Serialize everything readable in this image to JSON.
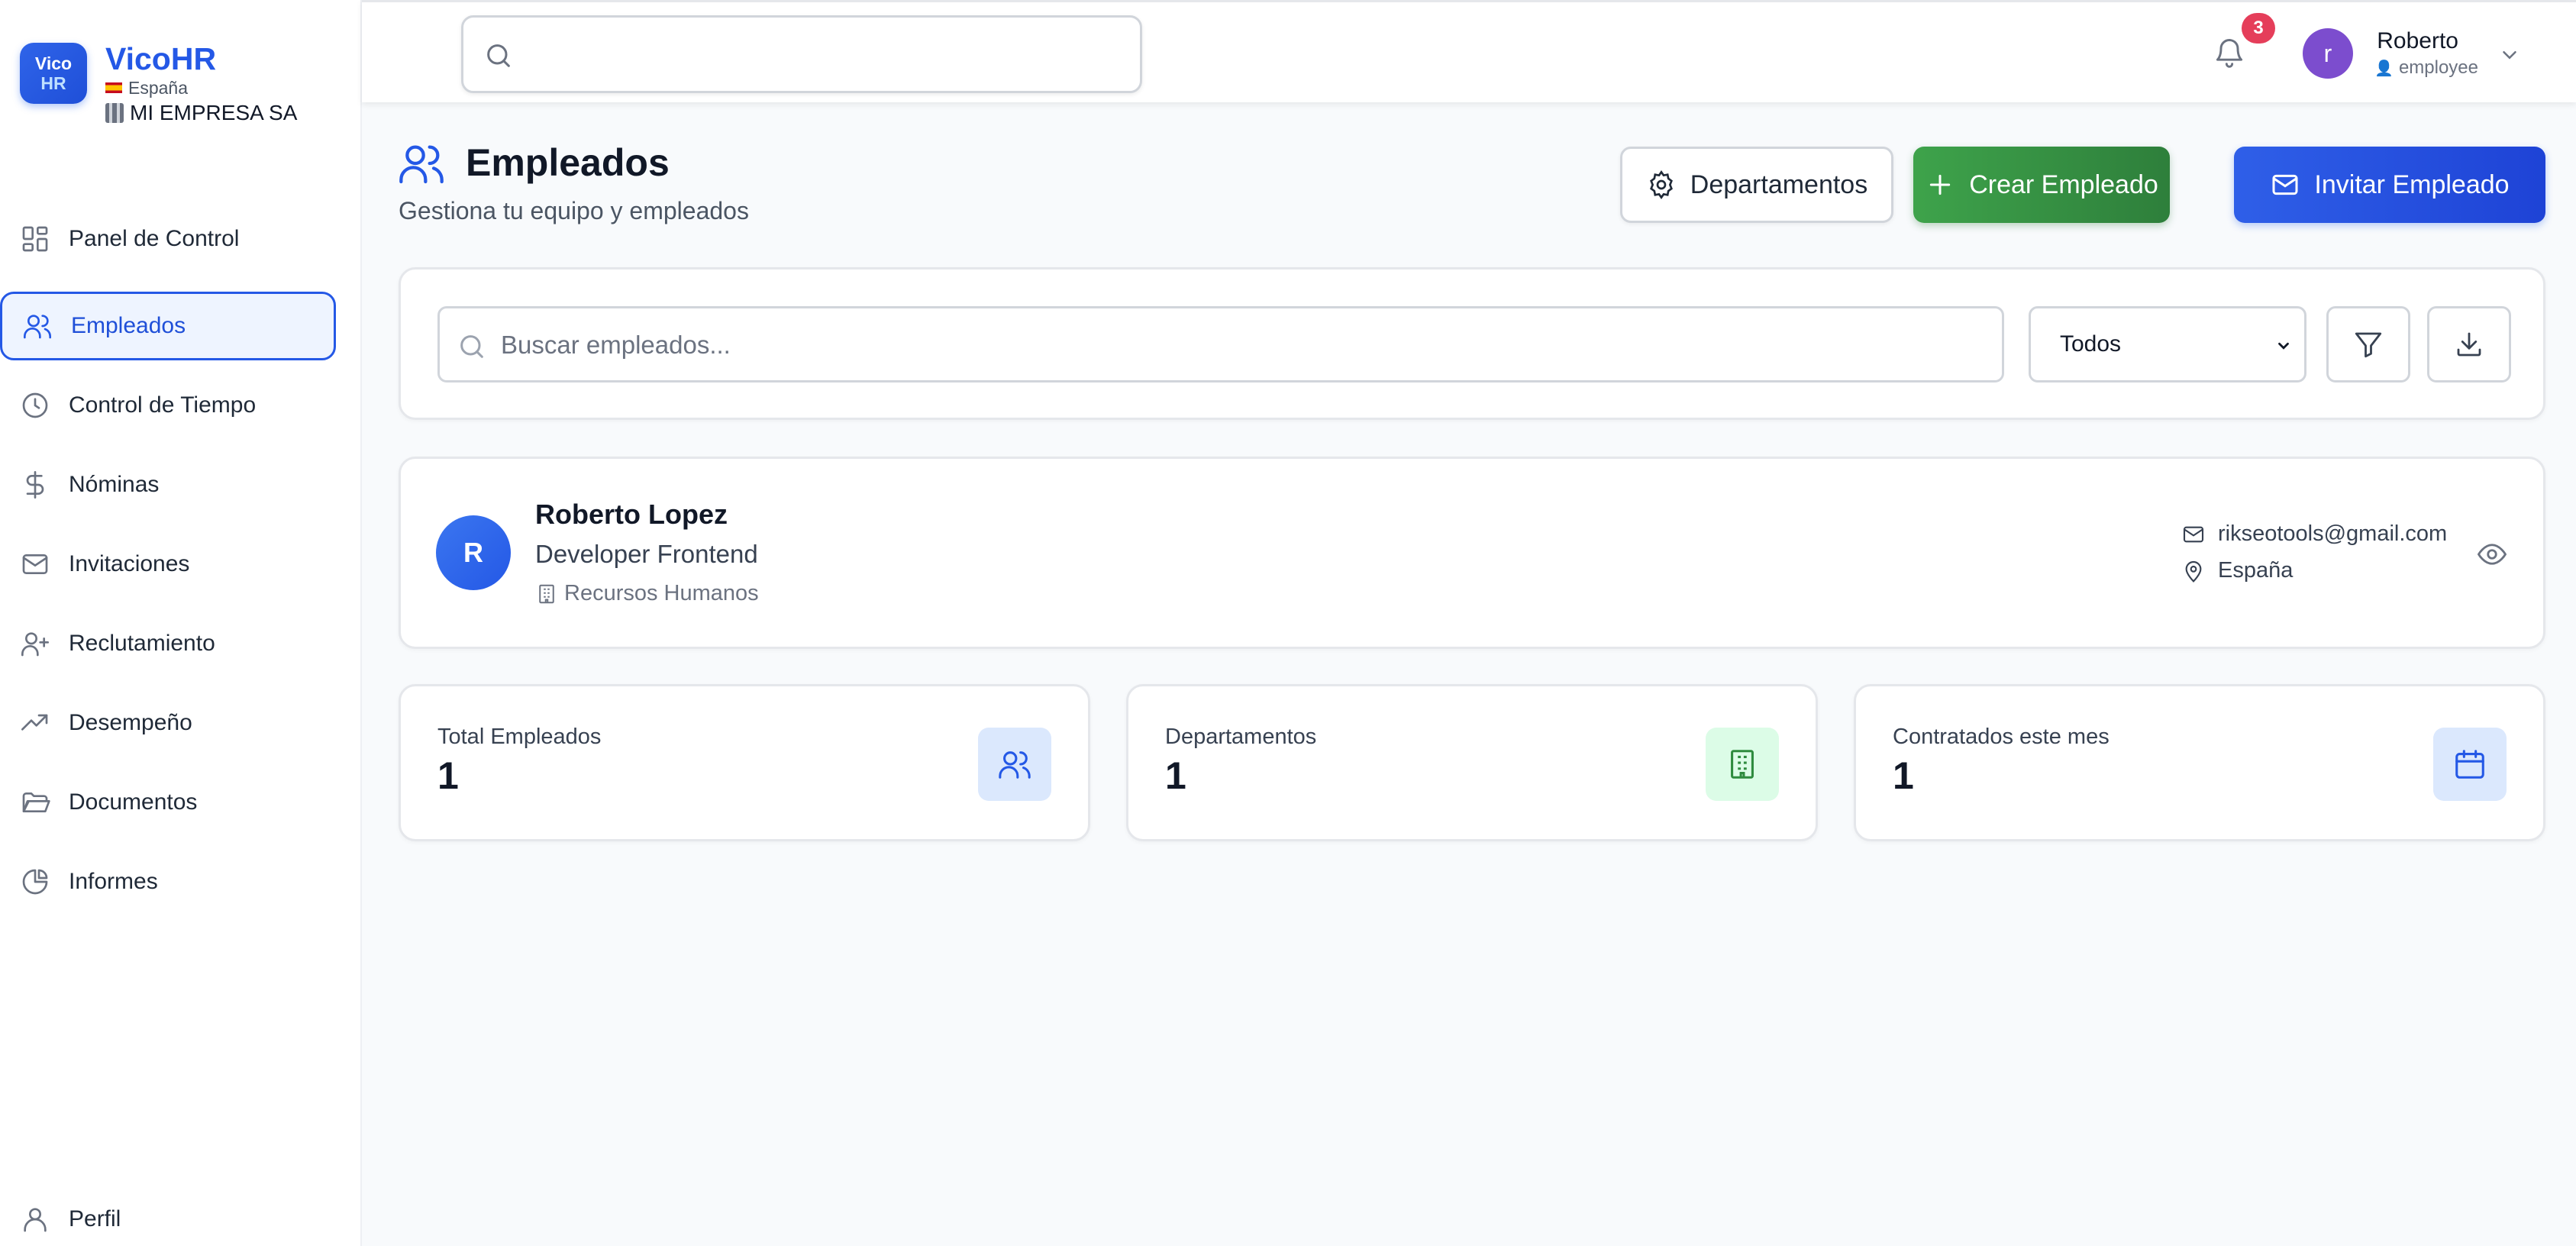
{
  "brand": {
    "logo_line1": "Vico",
    "logo_line2": "HR",
    "name": "VicoHR",
    "country": "España",
    "company": "MI EMPRESA SA"
  },
  "sidebar": {
    "items": [
      {
        "label": "Panel de Control",
        "icon": "dashboard-icon"
      },
      {
        "label": "Empleados",
        "icon": "users-icon",
        "active": true
      },
      {
        "label": "Control de Tiempo",
        "icon": "clock-icon"
      },
      {
        "label": "Nóminas",
        "icon": "dollar-icon"
      },
      {
        "label": "Invitaciones",
        "icon": "mail-icon"
      },
      {
        "label": "Reclutamiento",
        "icon": "user-plus-icon"
      },
      {
        "label": "Desempeño",
        "icon": "trending-up-icon"
      },
      {
        "label": "Documentos",
        "icon": "folder-icon"
      },
      {
        "label": "Informes",
        "icon": "pie-chart-icon"
      }
    ],
    "profile_label": "Perfil"
  },
  "topbar": {
    "search_placeholder": "",
    "notifications_count": "3",
    "user_initial": "r",
    "user_name": "Roberto",
    "user_role": "employee"
  },
  "page": {
    "title": "Empleados",
    "subtitle": "Gestiona tu equipo y empleados",
    "buttons": {
      "departments": "Departamentos",
      "create": "Crear Empleado",
      "invite": "Invitar Empleado"
    }
  },
  "filters": {
    "search_placeholder": "Buscar empleados...",
    "status_selected": "Todos"
  },
  "employees": [
    {
      "initial": "R",
      "name": "Roberto Lopez",
      "position": "Developer Frontend",
      "department": "Recursos Humanos",
      "email": "rikseotools@gmail.com",
      "location": "España"
    }
  ],
  "stats": [
    {
      "label": "Total Empleados",
      "value": "1",
      "icon": "users-icon"
    },
    {
      "label": "Departamentos",
      "value": "1",
      "icon": "building-icon"
    },
    {
      "label": "Contratados este mes",
      "value": "1",
      "icon": "calendar-icon"
    }
  ],
  "colors": {
    "primary": "#2458e6",
    "success": "#2e7f3b",
    "badge": "#e53e5a",
    "avatar": "#7c4dce"
  }
}
